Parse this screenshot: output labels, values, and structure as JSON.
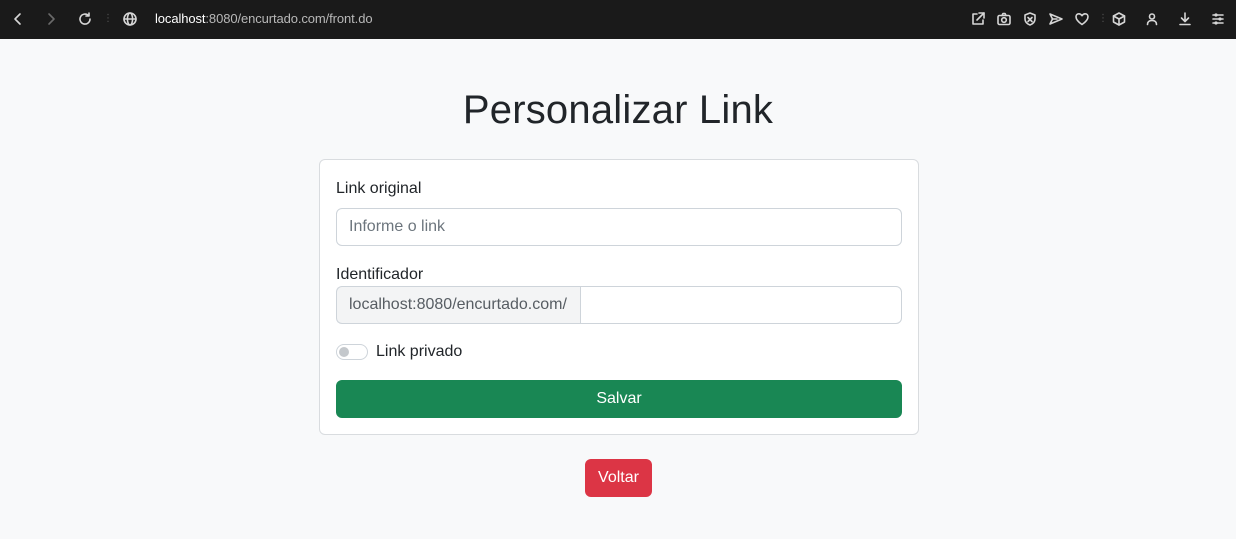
{
  "browser": {
    "url_host": "localhost",
    "url_rest": ":8080/encurtado.com/front.do",
    "icons": {
      "left": [
        "back-icon",
        "forward-icon",
        "reload-icon",
        "globe-icon"
      ],
      "right": [
        "share-icon",
        "camera-icon",
        "shield-icon",
        "send-icon",
        "heart-icon",
        "cube-icon",
        "profile-icon",
        "download-icon",
        "menu-icon"
      ]
    }
  },
  "page": {
    "title": "Personalizar Link"
  },
  "form": {
    "original_label": "Link original",
    "original_placeholder": "Informe o link",
    "original_value": "",
    "identifier_label": "Identificador",
    "identifier_prefix": "localhost:8080/encurtado.com/",
    "identifier_value": "",
    "private_label": "Link privado",
    "private_checked": false,
    "save_label": "Salvar"
  },
  "actions": {
    "back_label": "Voltar"
  },
  "colors": {
    "save": "#198754",
    "back": "#dc3545",
    "toolbar": "#1a1a1a",
    "background": "#f8f9fa"
  }
}
